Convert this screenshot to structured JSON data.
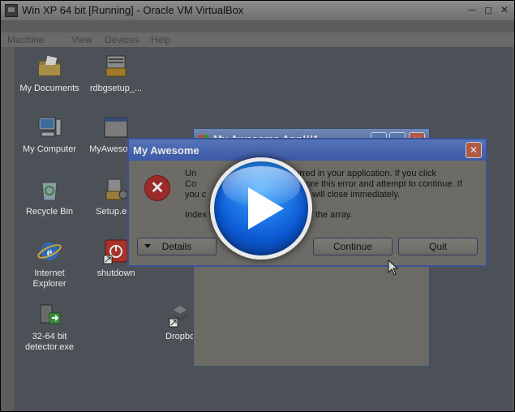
{
  "host": {
    "title": "Win XP 64 bit [Running] - Oracle VM VirtualBox",
    "menu": [
      "Machine",
      "View",
      "Devices",
      "Help"
    ]
  },
  "desktop": {
    "icons": [
      {
        "label": "My Documents",
        "icon": "folder-documents-icon"
      },
      {
        "label": "rdbgsetup_...",
        "icon": "installer-icon"
      },
      {
        "label": "My Computer",
        "icon": "computer-icon"
      },
      {
        "label": "MyAwesom...",
        "icon": "application-icon"
      },
      {
        "label": "Recycle Bin",
        "icon": "recycle-bin-icon"
      },
      {
        "label": "Setup.exe",
        "icon": "setup-icon"
      },
      {
        "label": "Internet Explorer",
        "icon": "internet-explorer-icon"
      },
      {
        "label": "shutdown",
        "icon": "shutdown-icon"
      },
      {
        "label": "32-64 bit detector.exe",
        "icon": "detector-icon"
      },
      {
        "label": "Dropbo",
        "icon": "dropbox-icon"
      }
    ]
  },
  "app_window": {
    "title": "My Awesome App!!!1"
  },
  "dialog": {
    "title": "My Awesome",
    "message_lines": [
      "Un                                    ccurred in your application. If you click",
      "Co                                    ill ignore this error and attempt to continue. If",
      "you c                                  ation will close immediately."
    ],
    "error_detail": "Index was outside the bounds of the array.",
    "buttons": {
      "details": "Details",
      "continue": "Continue",
      "quit": "Quit"
    }
  },
  "colors": {
    "dialog_border": "#3b5294",
    "play_button": "#0c59d4"
  }
}
